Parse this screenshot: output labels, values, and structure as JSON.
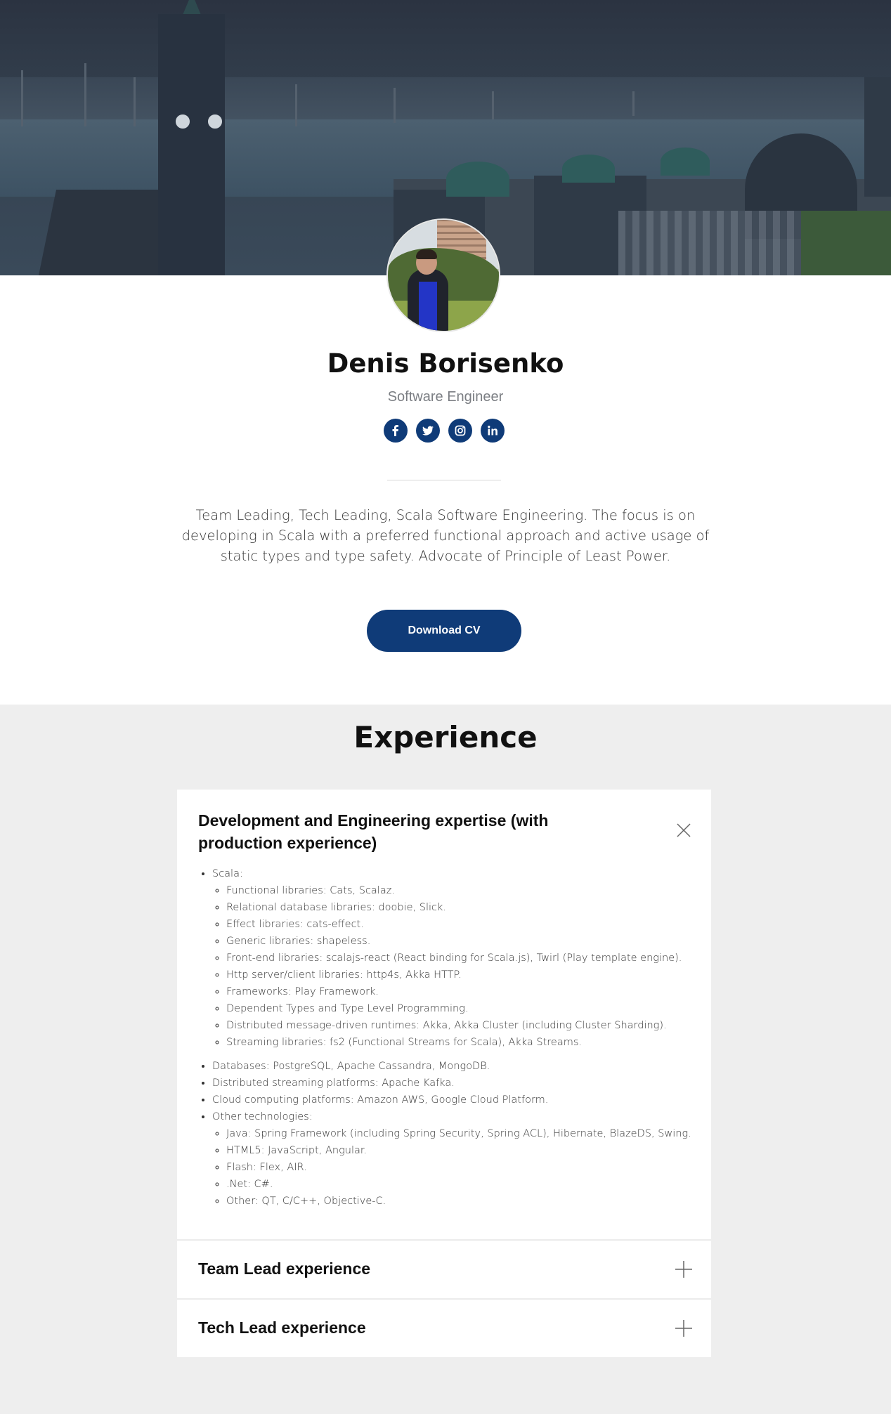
{
  "profile": {
    "name": "Denis Borisenko",
    "title": "Software Engineer",
    "socials": [
      {
        "icon": "facebook-icon"
      },
      {
        "icon": "twitter-icon"
      },
      {
        "icon": "instagram-icon"
      },
      {
        "icon": "linkedin-icon"
      }
    ],
    "summary": "Team Leading, Tech Leading, Scala Software Engineering. The focus is on developing in Scala with a preferred functional approach and active usage of static types and type safety. Advocate of Principle of Least Power.",
    "cta_label": "Download CV"
  },
  "experience": {
    "heading": "Experience",
    "panels": [
      {
        "title": "Development and Engineering expertise (with production experience)",
        "state": "expanded",
        "items": [
          {
            "label": "Scala:",
            "children": [
              "Functional libraries: Cats, Scalaz.",
              "Relational database libraries: doobie, Slick.",
              "Effect libraries: cats-effect.",
              "Generic libraries: shapeless.",
              "Front-end libraries: scalajs-react (React binding for Scala.js), Twirl (Play template engine).",
              "Http server/client libraries: http4s, Akka HTTP.",
              "Frameworks: Play Framework.",
              "Dependent Types and Type Level Programming.",
              "Distributed message-driven runtimes: Akka, Akka Cluster (including Cluster Sharding).",
              "Streaming libraries: fs2 (Functional Streams for Scala), Akka Streams."
            ]
          },
          {
            "label": "Databases: PostgreSQL, Apache Cassandra, MongoDB.",
            "children": []
          },
          {
            "label": "Distributed streaming platforms: Apache Kafka.",
            "children": []
          },
          {
            "label": "Cloud computing platforms: Amazon AWS, Google Cloud Platform.",
            "children": []
          },
          {
            "label": "Other technologies:",
            "children": [
              "Java: Spring Framework (including Spring Security, Spring ACL), Hibernate, BlazeDS, Swing.",
              "HTML5: JavaScript, Angular.",
              "Flash: Flex, AIR.",
              ".Net: C#.",
              "Other: QT, C/C++, Objective-C."
            ]
          }
        ]
      },
      {
        "title": "Team Lead experience",
        "state": "collapsed"
      },
      {
        "title": "Tech Lead experience",
        "state": "collapsed"
      }
    ]
  },
  "colors": {
    "accent": "#0f3b78",
    "section_bg": "#eeeeee",
    "muted_text": "#7b7e83"
  }
}
